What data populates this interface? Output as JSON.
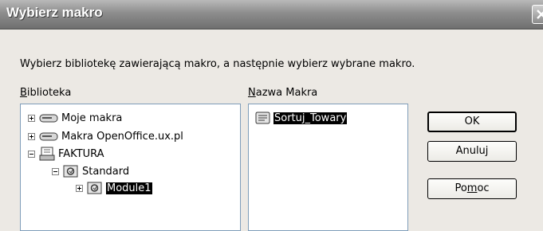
{
  "window": {
    "title": "Wybierz makro"
  },
  "prompt": "Wybierz bibliotekę zawierającą makro, a następnie wybierz wybrane makro.",
  "library": {
    "label_first": "B",
    "label_rest": "iblioteka",
    "tree": [
      {
        "label": "Moje makra",
        "icon": "drive-icon",
        "expander": "plus"
      },
      {
        "label": "Makra OpenOffice.ux.pl",
        "icon": "drive-icon",
        "expander": "plus"
      },
      {
        "label": "FAKTURA",
        "icon": "document-icon",
        "expander": "minus"
      },
      {
        "label": "Standard",
        "icon": "library-icon",
        "expander": "minus"
      },
      {
        "label": "Module1",
        "icon": "module-icon",
        "expander": "plus",
        "selected": true
      }
    ]
  },
  "macros": {
    "label_first": "N",
    "label_rest": "azwa Makra",
    "items": [
      {
        "label": "Sortuj_Towary",
        "icon": "macro-icon",
        "selected": true
      }
    ]
  },
  "buttons": {
    "ok": "OK",
    "cancel": "Anuluj",
    "help_pre": "Po",
    "help_accel": "m",
    "help_post": "oc"
  }
}
